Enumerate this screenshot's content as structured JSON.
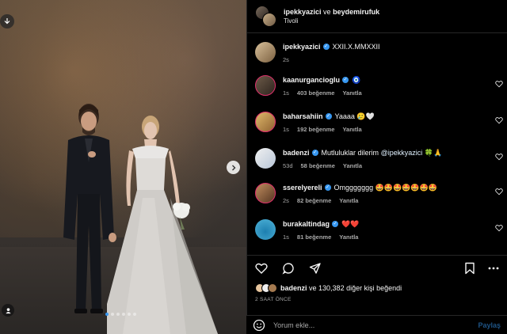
{
  "post": {
    "header": {
      "user1": "ipekkyazici",
      "conjunction": "ve",
      "user2": "beydemirufuk",
      "location": "Tivoli"
    },
    "caption": {
      "user": "ipekkyazici",
      "text": "XXII.X.MMXXII",
      "time": "2s"
    },
    "comments": [
      {
        "user": "kaanurgancioglu",
        "text": "🧿",
        "time": "1s",
        "likes": "403 beğenme",
        "reply": "Yanıtla"
      },
      {
        "user": "baharsahiin",
        "text": "Yaaaa 🥲🤍",
        "time": "1s",
        "likes": "192 beğenme",
        "reply": "Yanıtla"
      },
      {
        "user": "badenzi",
        "text": "Mutluluklar dilerim",
        "mention": "@ipekkyazici",
        "emoji": "🍀🙏",
        "time": "53d",
        "likes": "58 beğenme",
        "reply": "Yanıtla"
      },
      {
        "user": "sserelyereli",
        "text": "Omggggggg 🤩🤩🤩🤩🤩🤩🤩",
        "time": "2s",
        "likes": "82 beğenme",
        "reply": "Yanıtla"
      },
      {
        "user": "burakaltindag",
        "text": "❤️❤️",
        "time": "1s",
        "likes": "81 beğenme",
        "reply": "Yanıtla"
      }
    ],
    "likes_summary": {
      "user": "badenzi",
      "rest": "ve 130,382 diğer kişi beğendi"
    },
    "timestamp": "2 SAAT ÖNCE",
    "comment_box": {
      "placeholder": "Yorum ekle...",
      "post_label": "Paylaş"
    },
    "carousel": {
      "count": 6,
      "active": 1
    },
    "colors": {
      "accent": "#3797f0",
      "bg": "#000000",
      "muted": "#a8a8a8"
    }
  }
}
